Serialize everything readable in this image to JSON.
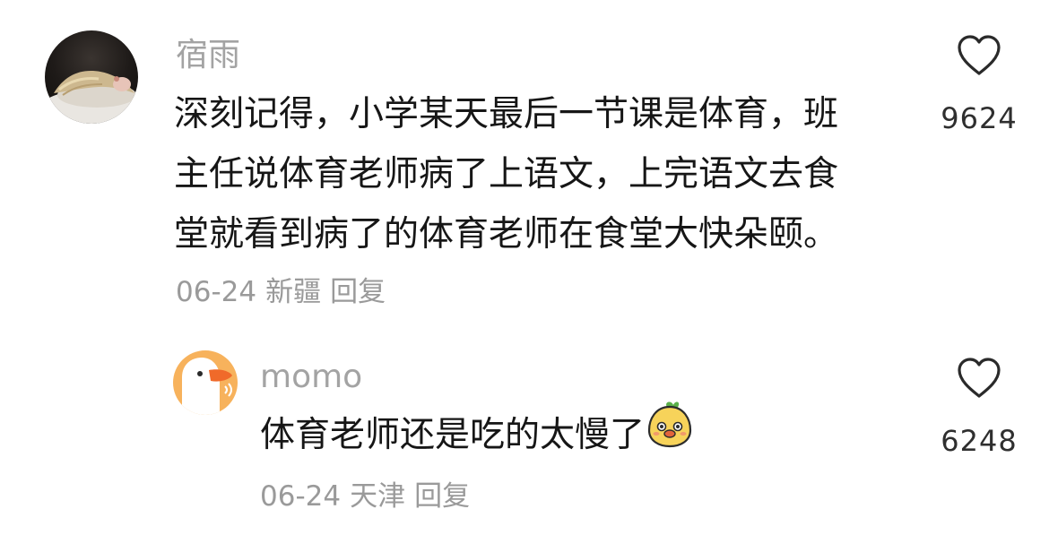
{
  "comment": {
    "username": "宿雨",
    "lines": [
      "深刻记得，小学某天最后一节课是体育，班",
      "主任说体育老师病了上语文，上完语文去食",
      "堂就看到病了的体育老师在食堂大快朵颐。"
    ],
    "date": "06-24",
    "location": "新疆",
    "reply_label": "回复",
    "likes": "9624"
  },
  "reply": {
    "username": "momo",
    "text": "体育老师还是吃的太慢了",
    "emoji": "smiling-pear-emoji",
    "date": "06-24",
    "location": "天津",
    "reply_label": "回复",
    "likes": "6248"
  },
  "icons": {
    "like": "heart-outline-icon"
  },
  "colors": {
    "username": "#a3a3a3",
    "content": "#161616",
    "meta": "#9a9a9a",
    "like_count": "#2f2f2f",
    "reply_avatar_bg": "#f7b25c"
  }
}
